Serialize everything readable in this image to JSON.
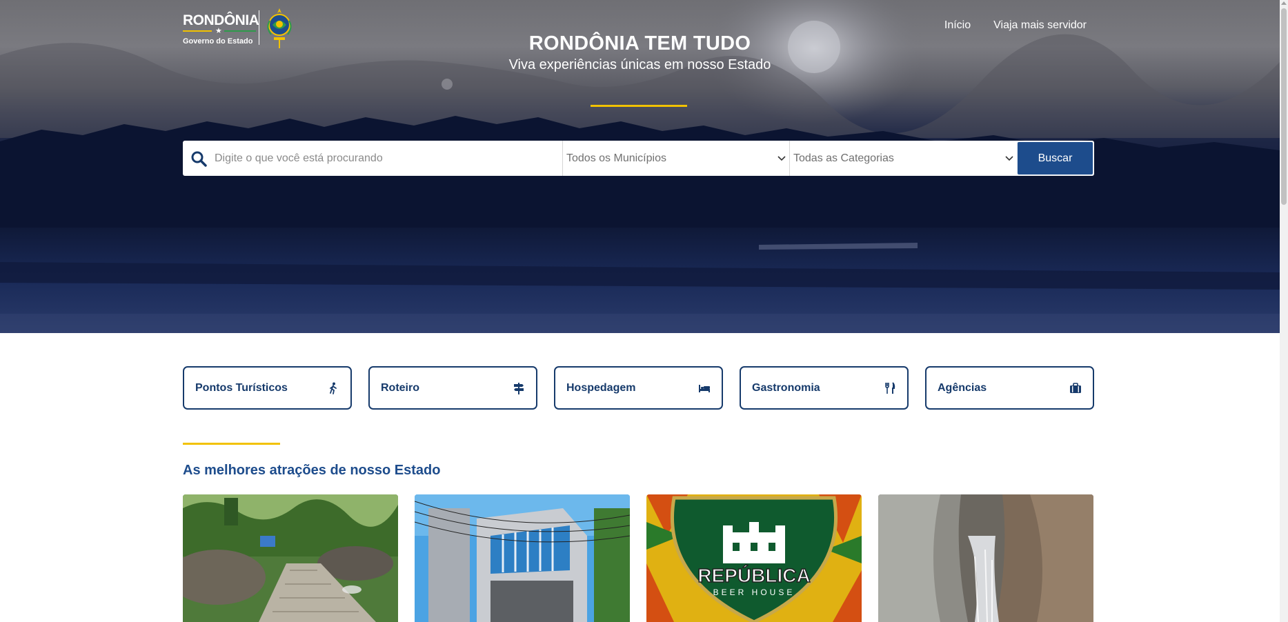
{
  "brand": {
    "logo_word": "RONDÔNIA",
    "logo_sub": "Governo do Estado",
    "accent_yellow": "#f2c200",
    "primary_blue": "#1d4c8c",
    "dark_blue": "#163a6b"
  },
  "nav": {
    "items": [
      {
        "label": "Início"
      },
      {
        "label": "Viaja mais servidor"
      }
    ]
  },
  "hero": {
    "title": "RONDÔNIA TEM TUDO",
    "subtitle": "Viva experiências únicas em nosso Estado"
  },
  "search": {
    "placeholder": "Digite o que você está procurando",
    "municipios_selected": "Todos os Municípios",
    "categorias_selected": "Todas as Categorias",
    "button_label": "Buscar"
  },
  "categories": [
    {
      "label": "Pontos Turísticos",
      "icon": "walking-person-icon"
    },
    {
      "label": "Roteiro",
      "icon": "signpost-icon"
    },
    {
      "label": "Hospedagem",
      "icon": "bed-icon"
    },
    {
      "label": "Gastronomia",
      "icon": "utensils-icon"
    },
    {
      "label": "Agências",
      "icon": "briefcase-icon"
    }
  ],
  "attractions": {
    "title": "As melhores atrações de nosso Estado",
    "cards": [
      {
        "name": "park-path-photo"
      },
      {
        "name": "building-photo"
      },
      {
        "name": "republica-beer-house-logo",
        "logo_text": "REPÚBLICA",
        "logo_sub": "BEER HOUSE"
      },
      {
        "name": "canyon-waterfall-photo"
      }
    ]
  }
}
